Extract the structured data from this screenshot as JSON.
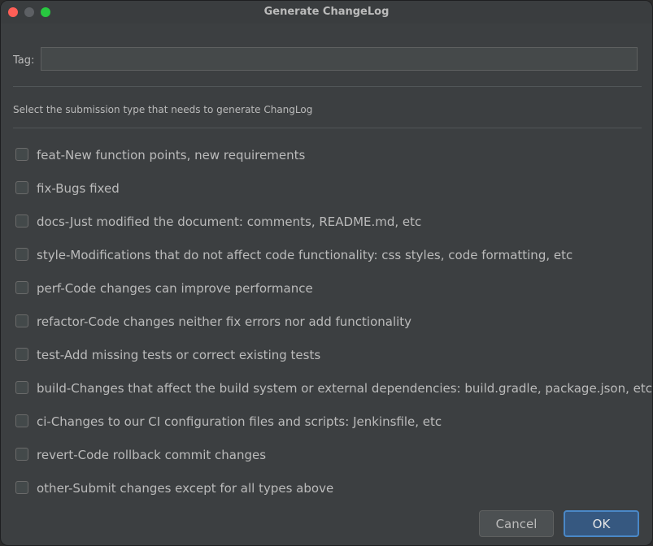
{
  "window": {
    "title": "Generate ChangeLog"
  },
  "tag": {
    "label": "Tag:",
    "value": "",
    "placeholder": ""
  },
  "instruction": "Select the submission type that needs to generate ChangLog",
  "options": [
    {
      "label": "feat-New function points, new requirements",
      "checked": false
    },
    {
      "label": "fix-Bugs fixed",
      "checked": false
    },
    {
      "label": "docs-Just modified the document: comments, README.md, etc",
      "checked": false
    },
    {
      "label": "style-Modifications that do not affect code functionality: css styles, code formatting, etc",
      "checked": false
    },
    {
      "label": "perf-Code changes can improve performance",
      "checked": false
    },
    {
      "label": "refactor-Code changes neither fix errors nor add functionality",
      "checked": false
    },
    {
      "label": "test-Add missing tests or correct existing tests",
      "checked": false
    },
    {
      "label": "build-Changes that affect the build system or external dependencies: build.gradle, package.json, etc",
      "checked": false
    },
    {
      "label": "ci-Changes to our CI configuration files and scripts: Jenkinsfile, etc",
      "checked": false
    },
    {
      "label": "revert-Code rollback commit changes",
      "checked": false
    },
    {
      "label": "other-Submit changes except for all types above",
      "checked": false
    }
  ],
  "buttons": {
    "cancel": "Cancel",
    "ok": "OK"
  },
  "colors": {
    "background": "#3c3f41",
    "text": "#bbbbbb",
    "accent": "#365880",
    "accent_border": "#4a88c7"
  }
}
